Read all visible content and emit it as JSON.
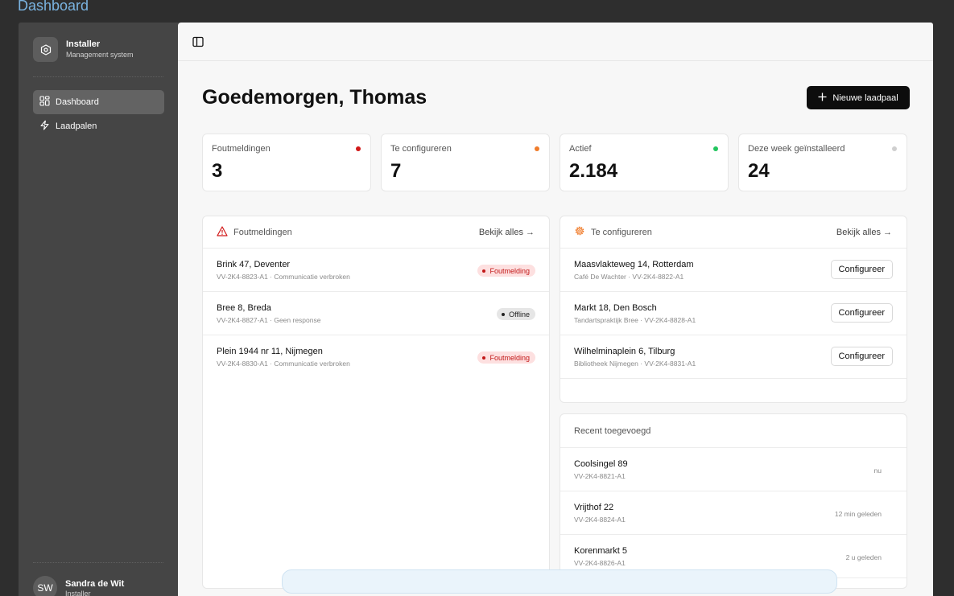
{
  "page_label": "Dashboard",
  "sidebar": {
    "brand_title": "Installer",
    "brand_subtitle": "Management system",
    "items": [
      {
        "label": "Dashboard",
        "icon": "grid-icon"
      },
      {
        "label": "Laadpalen",
        "icon": "lightning-icon"
      }
    ],
    "user": {
      "initials": "SW",
      "name": "Sandra de Wit",
      "role": "Installer"
    }
  },
  "main": {
    "greeting": "Goedemorgen, Thomas",
    "new_button": "Nieuwe laadpaal",
    "stats": [
      {
        "label": "Foutmeldingen",
        "value": "3",
        "color": "#d11919"
      },
      {
        "label": "Te configureren",
        "value": "7",
        "color": "#f07c2b"
      },
      {
        "label": "Actief",
        "value": "2.184",
        "color": "#22c55e"
      },
      {
        "label": "Deze week geïnstalleerd",
        "value": "24",
        "color": "#cfcfcf"
      }
    ],
    "errors_panel": {
      "title": "Foutmeldingen",
      "link": "Bekijk alles →",
      "rows": [
        {
          "title": "Brink 47, Deventer",
          "sub": "VV-2K4-8823-A1 · Communicatie verbroken",
          "badge": "Foutmelding"
        },
        {
          "title": "Bree 8, Breda",
          "sub": "VV-2K4-8827-A1 · Geen response",
          "badge": "Offline"
        },
        {
          "title": "Plein 1944 nr 11, Nijmegen",
          "sub": "VV-2K4-8830-A1 · Communicatie verbroken",
          "badge": "Foutmelding"
        }
      ]
    },
    "config_panel": {
      "title": "Te configureren",
      "link": "Bekijk alles →",
      "button": "Configureer",
      "rows": [
        {
          "title": "Maasvlakteweg 14, Rotterdam",
          "sub": "Café De Wachter · VV-2K4-8822-A1"
        },
        {
          "title": "Markt 18, Den Bosch",
          "sub": "Tandartspraktijk Bree · VV-2K4-8828-A1"
        },
        {
          "title": "Wilhelminaplein 6, Tilburg",
          "sub": "Bibliotheek Nijmegen · VV-2K4-8831-A1"
        }
      ]
    },
    "recent_panel": {
      "title": "Recent toegevoegd",
      "rows": [
        {
          "title": "Coolsingel 89",
          "sub": "VV-2K4-8821-A1",
          "time": "nu"
        },
        {
          "title": "Vrijthof 22",
          "sub": "VV-2K4-8824-A1",
          "time": "12 min geleden"
        },
        {
          "title": "Korenmarkt 5",
          "sub": "VV-2K4-8826-A1",
          "time": "2 u geleden"
        }
      ]
    }
  }
}
